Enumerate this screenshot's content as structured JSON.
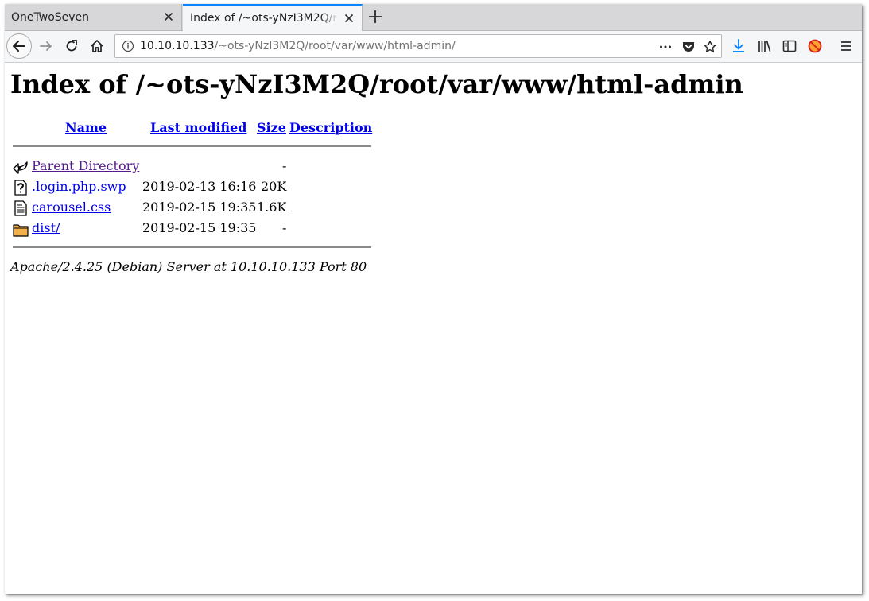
{
  "browser": {
    "tabs": [
      {
        "title": "OneTwoSeven",
        "active": false
      },
      {
        "title": "Index of /~ots-yNzI3M2Q/root/var/www/html-admin",
        "active": true
      }
    ],
    "url_host": "10.10.10.133",
    "url_path": "/~ots-yNzI3M2Q/root/var/www/html-admin/",
    "accent_color": "#0a84ff"
  },
  "page": {
    "title": "Index of /~ots-yNzI3M2Q/root/var/www/html-admin",
    "columns": {
      "name": "Name",
      "last_modified": "Last modified",
      "size": "Size",
      "description": "Description"
    },
    "rows": [
      {
        "icon": "back-icon",
        "name": "Parent Directory",
        "modified": "",
        "size": "-",
        "visited": true
      },
      {
        "icon": "unknown-file-icon",
        "name": ".login.php.swp",
        "modified": "2019-02-13 16:16",
        "size": "20K",
        "visited": false
      },
      {
        "icon": "text-file-icon",
        "name": "carousel.css",
        "modified": "2019-02-15 19:35",
        "size": "1.6K",
        "visited": false
      },
      {
        "icon": "folder-icon",
        "name": "dist/",
        "modified": "2019-02-15 19:35",
        "size": "-",
        "visited": false
      }
    ],
    "address": "Apache/2.4.25 (Debian) Server at 10.10.10.133 Port 80"
  }
}
